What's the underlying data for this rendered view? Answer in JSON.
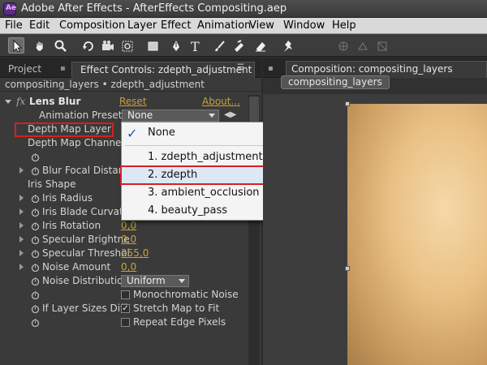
{
  "window": {
    "title": "Adobe After Effects - AfterEffects Compositing.aep"
  },
  "menu": [
    "File",
    "Edit",
    "Composition",
    "Layer",
    "Effect",
    "Animation",
    "View",
    "Window",
    "Help"
  ],
  "left_panel": {
    "tabs": {
      "project": "Project",
      "effect_controls": "Effect Controls: zdepth_adjustment"
    },
    "subheader": "compositing_layers • zdepth_adjustment",
    "effect": {
      "name": "Lens Blur",
      "fx": "fx",
      "reset": "Reset",
      "about": "About...",
      "animation_presets_label": "Animation Presets:",
      "animation_presets_value": "None"
    },
    "properties": [
      {
        "label": "Depth Map Layer"
      },
      {
        "label": "Depth Map Channel"
      },
      {
        "label": ""
      },
      {
        "label": "Blur Focal Distan"
      },
      {
        "label": "Iris Shape"
      },
      {
        "label": "Iris Radius"
      },
      {
        "label": "Iris Blade Curvatu"
      },
      {
        "label": "Iris Rotation",
        "value": "0,0"
      },
      {
        "label": "Specular Brightne",
        "value": "0,0"
      },
      {
        "label": "Specular Threshol",
        "value": "255,0"
      },
      {
        "label": "Noise Amount",
        "value": "0,0"
      },
      {
        "label": "Noise Distributio",
        "value": "Uniform"
      },
      {
        "label": "",
        "check_label": "Monochromatic Noise",
        "checked": false
      },
      {
        "label": "If Layer Sizes Diff",
        "check_label": "Stretch Map to Fit",
        "checked": true
      },
      {
        "label": "",
        "check_label": "Repeat Edge Pixels",
        "checked": false
      }
    ]
  },
  "popup": {
    "items": [
      {
        "label": "None",
        "checked": true
      },
      {
        "label": "1. zdepth_adjustment"
      },
      {
        "label": "2. zdepth",
        "highlighted": true
      },
      {
        "label": "3. ambient_occlusion"
      },
      {
        "label": "4. beauty_pass"
      }
    ]
  },
  "right_panel": {
    "tab": "Composition: compositing_layers",
    "comp_chip": "compositing_layers"
  },
  "colors": {
    "accent_value": "#c8a23a",
    "highlight_box": "#d42121"
  }
}
